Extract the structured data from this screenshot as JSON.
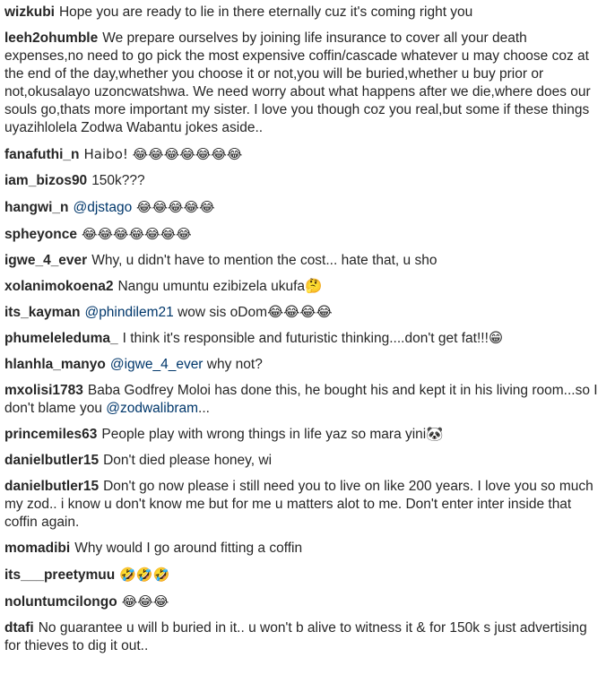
{
  "comments": [
    {
      "user": "wizkubi",
      "text": "Hope you are ready to lie in there eternally cuz it's coming right you"
    },
    {
      "user": "leeh2ohumble",
      "text": "We prepare ourselves by joining life insurance to cover all your death expenses,no need to go pick the most expensive coffin/cascade whatever u may choose coz at the end of the day,whether you choose it or not,you will be buried,whether u buy prior or not,okusalayo uzoncwatshwa. We need worry about what happens after we die,where does our souls go,thats more important my sister. I love you though coz you real,but some if these things uyazihlolela Zodwa Wabantu jokes aside.."
    },
    {
      "user": "fanafuthi_n",
      "text": "Haibo! 😂😂😂😂😂😂😂"
    },
    {
      "user": "iam_bizos90",
      "text": "150k???"
    },
    {
      "user": "hangwi_n",
      "mention": "@djstago",
      "text": " 😂😂😂😂😂"
    },
    {
      "user": "spheyonce",
      "text": "😂😂😂😂😂😂😂"
    },
    {
      "user": "igwe_4_ever",
      "text": "Why, u didn't have to mention the cost... hate that, u sho"
    },
    {
      "user": "xolanimokoena2",
      "text": "Nangu umuntu ezibizela ukufa🤔"
    },
    {
      "user": "its_kayman",
      "mention": "@phindilem21",
      "text": " wow sis oDom😂😂😂😂"
    },
    {
      "user": "phumeleleduma_",
      "text": "I think it's responsible and futuristic thinking....don't get fat!!!😁"
    },
    {
      "user": "hlanhla_manyo",
      "mention": "@igwe_4_ever",
      "text": " why not?"
    },
    {
      "user": "mxolisi1783",
      "text": "Baba Godfrey Moloi has done this, he bought his and kept it in his living room...so I don't blame you ",
      "mention_end": "@zodwalibram",
      "text_end": "..."
    },
    {
      "user": "princemiles63",
      "text": "People play with wrong things in life yaz so mara yini🐼"
    },
    {
      "user": "danielbutler15",
      "text": "Don't died please honey, wi"
    },
    {
      "user": "danielbutler15",
      "text": "Don't go now please i still need you to live on like 200 years. I love you so much my zod.. i know u don't know me but for me u matters alot to me. Don't enter inter inside that coffin again."
    },
    {
      "user": "momadibi",
      "text": "Why would I go around fitting a coffin"
    },
    {
      "user": "its___preetymuu",
      "text": "🤣🤣🤣"
    },
    {
      "user": "noluntumcilongo",
      "text": "😂😂😂"
    },
    {
      "user": "dtafi",
      "text": "No guarantee u will b buried in it.. u won't b alive to witness it & for 150k s just advertising for thieves to dig it out.."
    }
  ]
}
